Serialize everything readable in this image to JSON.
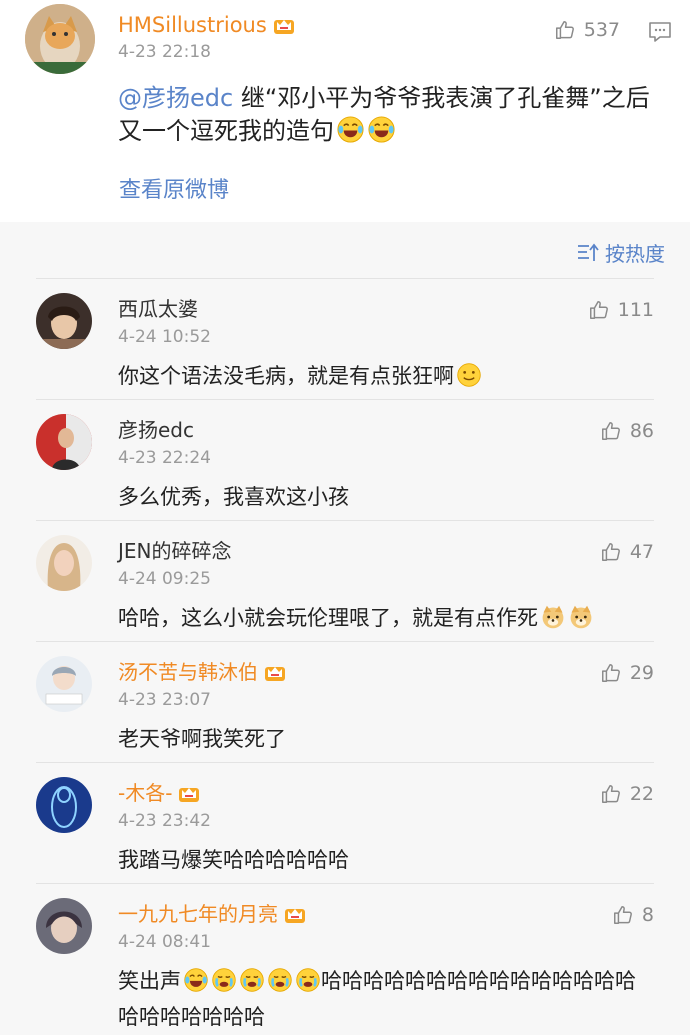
{
  "post": {
    "username": "HMSillustrious",
    "time": "4-23 22:18",
    "likes": "537",
    "mention": "@彦扬edc",
    "text": " 继“邓小平为爷爷我表演了孔雀舞”之后又一个逗死我的造句",
    "view_original": "查看原微博"
  },
  "sort": {
    "label": "按热度"
  },
  "colors": {
    "accent": "#5a84c9",
    "vip_name": "#f08a24"
  },
  "comments": [
    {
      "username": "西瓜太婆",
      "time": "4-24 10:52",
      "likes": "111",
      "text": "你这个语法没毛病，就是有点张狂啊"
    },
    {
      "username": "彦扬edc",
      "time": "4-23 22:24",
      "likes": "86",
      "text": "多么优秀，我喜欢这小孩"
    },
    {
      "username": "JEN的碎碎念",
      "time": "4-24 09:25",
      "likes": "47",
      "text": "哈哈，这么小就会玩伦理哏了，就是有点作死"
    },
    {
      "username": "汤不苦与韩沐伯",
      "time": "4-23 23:07",
      "likes": "29",
      "text": "老天爷啊我笑死了"
    },
    {
      "username": "-木各-",
      "time": "4-23 23:42",
      "likes": "22",
      "text": "我踏马爆笑哈哈哈哈哈哈"
    },
    {
      "username": "一九九七年的月亮",
      "time": "4-24 08:41",
      "likes": "8",
      "text_a": "笑出声",
      "text_b": "哈哈哈哈哈哈哈哈哈哈哈哈哈哈哈哈哈哈哈哈哈哈"
    }
  ]
}
